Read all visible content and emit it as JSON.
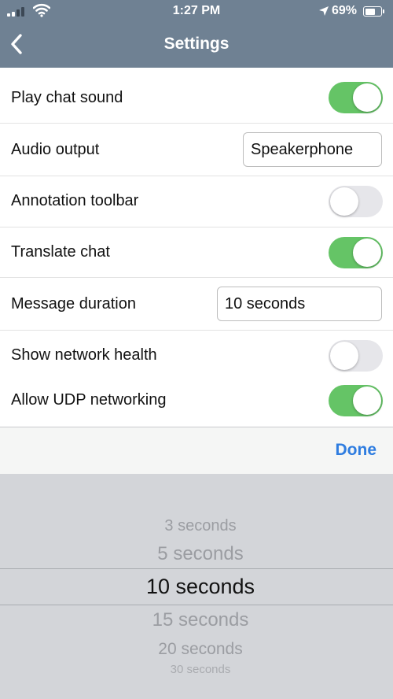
{
  "status_bar": {
    "time": "1:27 PM",
    "battery_percent": "69%",
    "battery_level": 0.69
  },
  "nav": {
    "title": "Settings",
    "back_icon": "chevron-left-icon"
  },
  "settings": {
    "play_chat_sound": {
      "label": "Play chat sound",
      "enabled": true
    },
    "audio_output": {
      "label": "Audio output",
      "value": "Speakerphone"
    },
    "annotation_toolbar": {
      "label": "Annotation toolbar",
      "enabled": false
    },
    "translate_chat": {
      "label": "Translate chat",
      "enabled": true
    },
    "message_duration": {
      "label": "Message duration",
      "value": "10 seconds"
    },
    "show_network_health": {
      "label": "Show network health",
      "enabled": false
    },
    "allow_udp_networking": {
      "label": "Allow UDP networking",
      "enabled": true
    }
  },
  "picker": {
    "done_label": "Done",
    "options": [
      "3 seconds",
      "5 seconds",
      "10 seconds",
      "15 seconds",
      "20 seconds",
      "30 seconds"
    ],
    "selected": "10 seconds"
  },
  "colors": {
    "header": "#6f8193",
    "toggle_on": "#65c466",
    "toggle_off": "#e6e6ea",
    "done": "#2f7de0",
    "picker_bg": "#d3d5d9"
  }
}
